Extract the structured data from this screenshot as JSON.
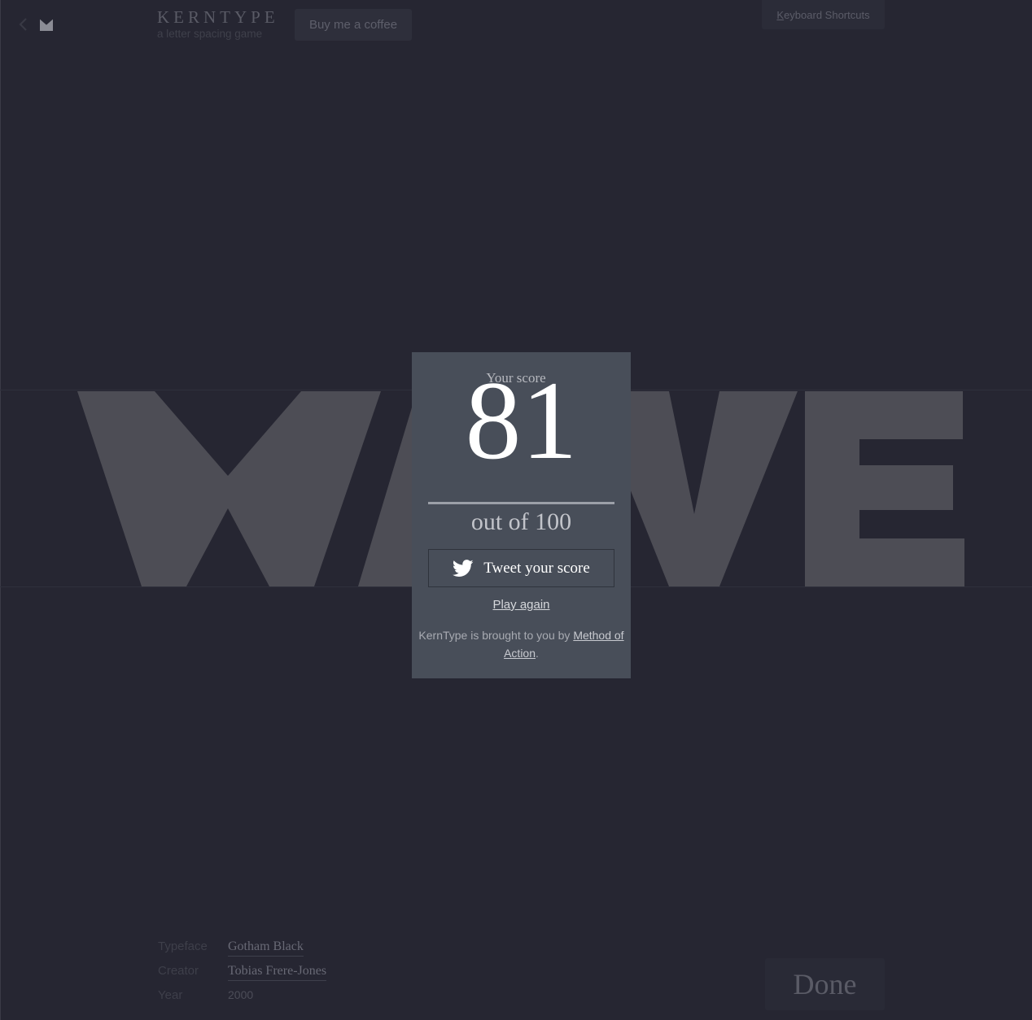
{
  "header": {
    "brand_title": "KERNTYPE",
    "brand_subtitle": "a letter spacing game",
    "coffee_label": "Buy me a coffee",
    "shortcuts_label": "Keyboard Shortcuts",
    "shortcuts_underline_letter": "K",
    "shortcuts_rest": "eyboard Shortcuts"
  },
  "game": {
    "word": "WAVE",
    "word_color": "#4d4d55"
  },
  "score_modal": {
    "label": "Your score",
    "score": "81",
    "out_of": "out of 100",
    "tweet_label": "Tweet your score",
    "play_again": "Play again",
    "credit_prefix": "KernType is brought to you by ",
    "credit_link": "Method of Action",
    "credit_suffix": "."
  },
  "font_info": {
    "typeface_label": "Typeface",
    "typeface_value": "Gotham Black",
    "creator_label": "Creator",
    "creator_value": "Tobias Frere-Jones",
    "year_label": "Year",
    "year_value": "2000"
  },
  "done_label": "Done",
  "colors": {
    "background": "#262632",
    "modal": "#484e59",
    "accent_white": "#ffffff"
  },
  "icons": [
    "back-arrow-icon",
    "method-of-action-logo-icon",
    "twitter-bird-icon"
  ]
}
